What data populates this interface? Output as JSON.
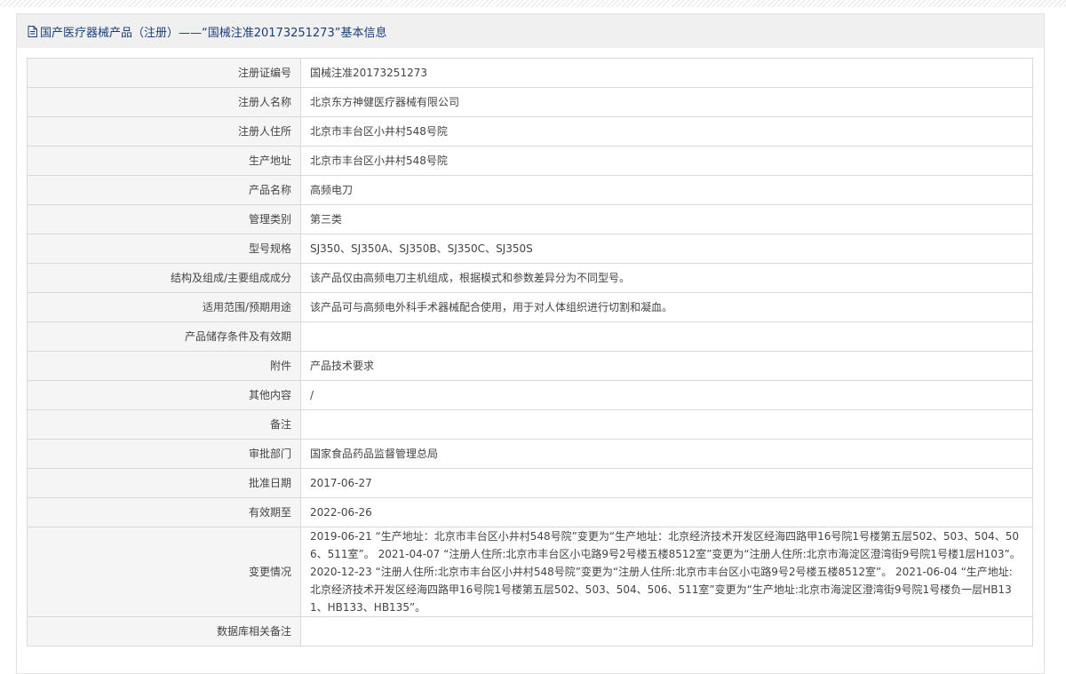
{
  "header": {
    "title": "国产医疗器械产品（注册）——“国械注准20173251273”基本信息",
    "icon": "document-icon"
  },
  "rows": [
    {
      "label": "注册证编号",
      "value": "国械注准20173251273"
    },
    {
      "label": "注册人名称",
      "value": "北京东方神健医疗器械有限公司"
    },
    {
      "label": "注册人住所",
      "value": "北京市丰台区小井村548号院"
    },
    {
      "label": "生产地址",
      "value": "北京市丰台区小井村548号院"
    },
    {
      "label": "产品名称",
      "value": "高频电刀"
    },
    {
      "label": "管理类别",
      "value": "第三类"
    },
    {
      "label": "型号规格",
      "value": "SJ350、SJ350A、SJ350B、SJ350C、SJ350S"
    },
    {
      "label": "结构及组成/主要组成成分",
      "value": "该产品仅由高频电刀主机组成，根据模式和参数差异分为不同型号。"
    },
    {
      "label": "适用范围/预期用途",
      "value": "该产品可与高频电外科手术器械配合使用，用于对人体组织进行切割和凝血。"
    },
    {
      "label": "产品储存条件及有效期",
      "value": ""
    },
    {
      "label": "附件",
      "value": "产品技术要求"
    },
    {
      "label": "其他内容",
      "value": "/"
    },
    {
      "label": "备注",
      "value": ""
    },
    {
      "label": "审批部门",
      "value": "国家食品药品监督管理总局"
    },
    {
      "label": "批准日期",
      "value": "2017-06-27"
    },
    {
      "label": "有效期至",
      "value": "2022-06-26"
    },
    {
      "label": "变更情况",
      "value": "2019-06-21 “生产地址：北京市丰台区小井村548号院”变更为“生产地址：北京经济技术开发区经海四路甲16号院1号楼第五层502、503、504、506、511室”。 2021-04-07 “注册人住所:北京市丰台区小屯路9号2号楼五楼8512室”变更为“注册人住所:北京市海淀区澄湾街9号院1号楼1层H103”。 2020-12-23 “注册人住所:北京市丰台区小井村548号院”变更为“注册人住所:北京市丰台区小屯路9号2号楼五楼8512室”。 2021-06-04 “生产地址:北京经济技术开发区经海四路甲16号院1号楼第五层502、503、504、506、511室”变更为“生产地址:北京市海淀区澄湾街9号院1号楼负一层HB131、HB133、HB135”。"
    },
    {
      "label": "数据库相关备注",
      "value": ""
    }
  ]
}
